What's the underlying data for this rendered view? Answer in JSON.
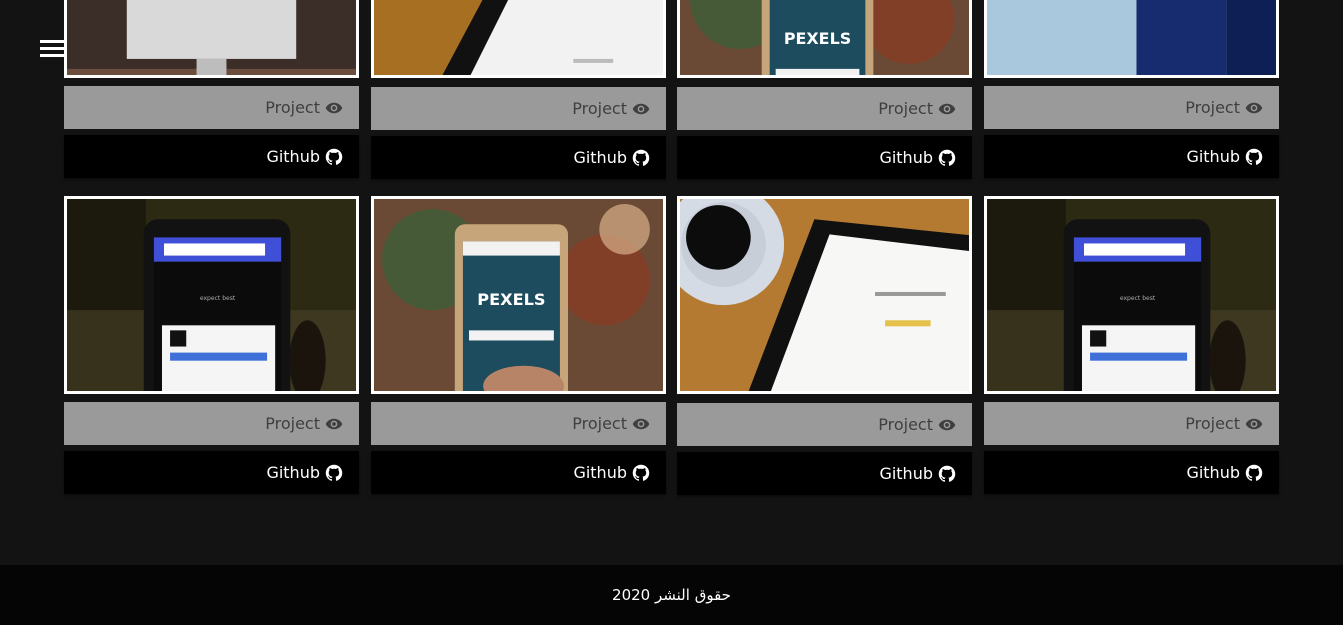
{
  "menu": {
    "icon": "hamburger-icon"
  },
  "projects": [
    {
      "thumb": "imac-desk",
      "project_label": "Project",
      "github_label": "Github"
    },
    {
      "thumb": "tablet-desk",
      "project_label": "Project",
      "github_label": "Github"
    },
    {
      "thumb": "phone-pexels",
      "project_label": "Project",
      "github_label": "Github"
    },
    {
      "thumb": "website-collage",
      "project_label": "Project",
      "github_label": "Github"
    },
    {
      "thumb": "phone-dark",
      "project_label": "Project",
      "github_label": "Github"
    },
    {
      "thumb": "phone-pexels",
      "project_label": "Project",
      "github_label": "Github"
    },
    {
      "thumb": "tablet-coffee",
      "project_label": "Project",
      "github_label": "Github"
    },
    {
      "thumb": "phone-dark",
      "project_label": "Project",
      "github_label": "Github"
    }
  ],
  "icons": {
    "project": "eye-icon",
    "github": "github-icon"
  },
  "footer": {
    "text": "حقوق النشر 2020"
  }
}
